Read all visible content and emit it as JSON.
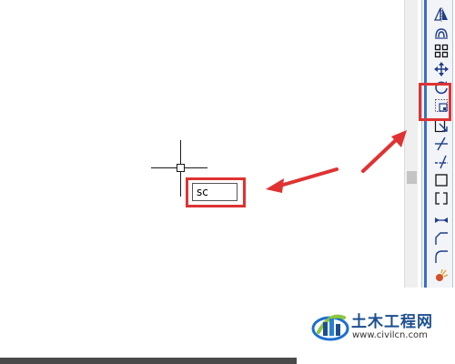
{
  "top_strip_text": "·· ·· ·· ·· ··",
  "command_line": {
    "input_value": "sc"
  },
  "toolbar": {
    "tools": [
      {
        "name": "mirror-tool",
        "icon": "mirror-icon"
      },
      {
        "name": "offset-tool",
        "icon": "offset-icon"
      },
      {
        "name": "array-tool",
        "icon": "array-icon"
      },
      {
        "name": "move-tool",
        "icon": "move-icon"
      },
      {
        "name": "rotate-tool",
        "icon": "rotate-icon"
      },
      {
        "name": "scale-tool",
        "icon": "scale-icon",
        "highlighted": true
      },
      {
        "name": "stretch-tool",
        "icon": "stretch-icon"
      },
      {
        "name": "trim-tool",
        "icon": "trim-icon"
      },
      {
        "name": "extend-tool",
        "icon": "extend-icon"
      },
      {
        "name": "break-at-point-tool",
        "icon": "break-at-point-icon"
      },
      {
        "name": "break-tool",
        "icon": "break-icon"
      },
      {
        "name": "join-tool",
        "icon": "join-icon"
      },
      {
        "name": "chamfer-tool",
        "icon": "chamfer-icon"
      },
      {
        "name": "fillet-tool",
        "icon": "fillet-icon"
      },
      {
        "name": "explode-tool",
        "icon": "explode-icon"
      }
    ]
  },
  "annotations": {
    "highlight_color": "#e03232"
  },
  "watermark": {
    "title": "土木工程网",
    "url": "www.civilcn.com"
  }
}
